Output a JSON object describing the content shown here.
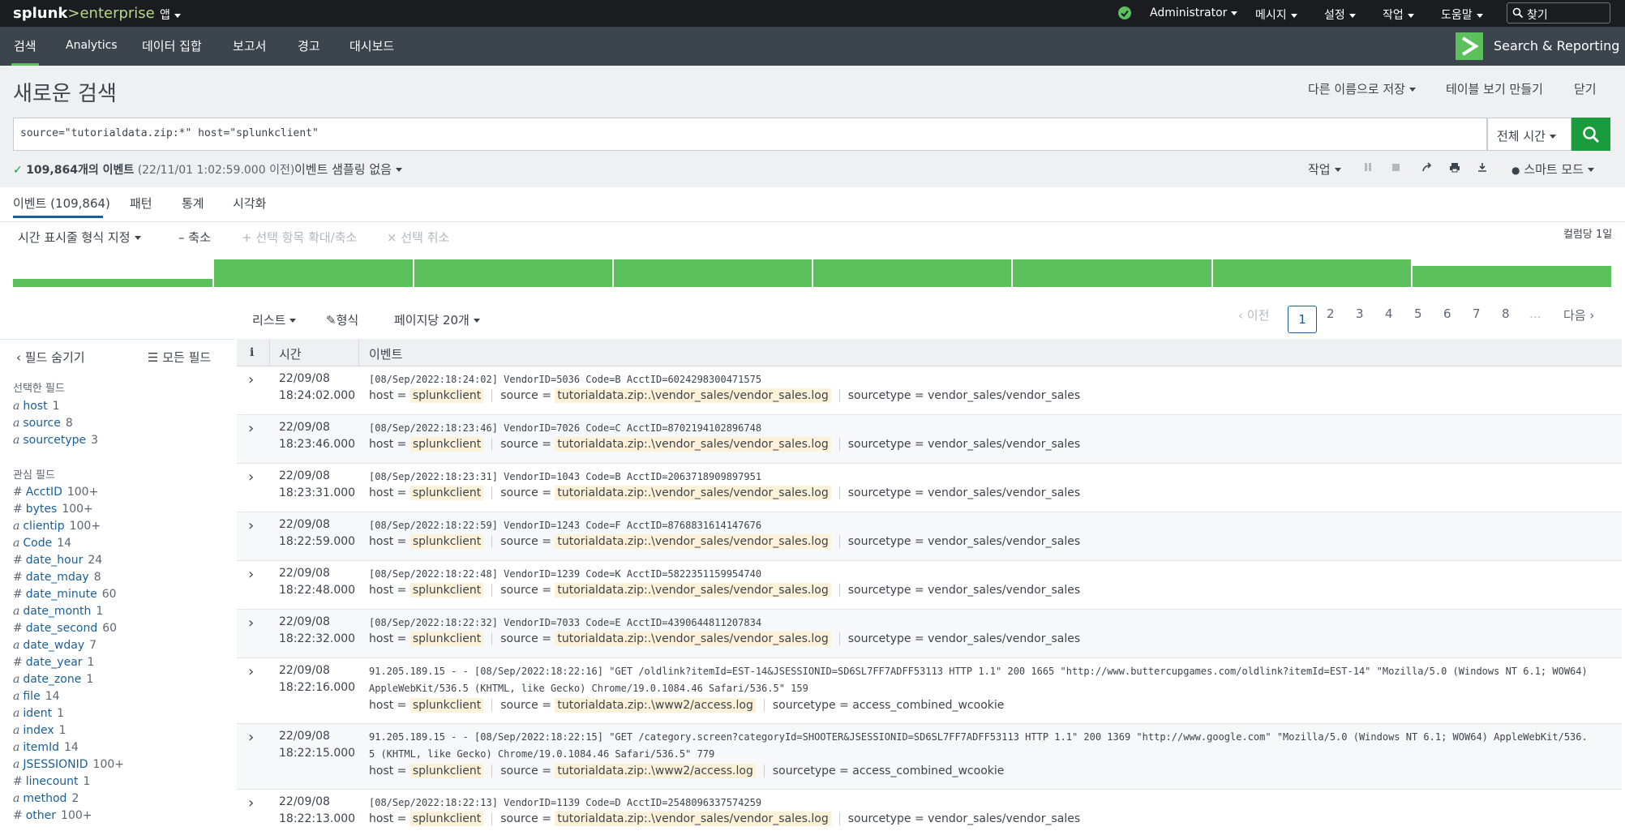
{
  "brand": {
    "logo_a": "splunk",
    "logo_b": ">enterprise"
  },
  "topbar": {
    "app": "앱",
    "user": "Administrator",
    "messages": "메시지",
    "settings": "설정",
    "activity": "작업",
    "help": "도움말",
    "search_placeholder": "찾기"
  },
  "navbar": {
    "items": [
      "검색",
      "Analytics",
      "데이터 집합",
      "보고서",
      "경고",
      "대시보드"
    ],
    "app_title": "Search & Reporting"
  },
  "page": {
    "title": "새로운 검색",
    "save_as": "다른 이름으로 저장",
    "create_table": "테이블 보기 만들기",
    "close": "닫기"
  },
  "search": {
    "query": "source=\"tutorialdata.zip:*\" host=\"splunkclient\"",
    "time_range": "전체 시간"
  },
  "status": {
    "count": "109,864개의 이벤트",
    "range": "(22/11/01 1:02:59.000 이전)",
    "sampling": "이벤트 샘플링 없음",
    "job": "작업",
    "mode": "스마트 모드"
  },
  "tabs": [
    "이벤트 (109,864)",
    "패턴",
    "통계",
    "시각화"
  ],
  "timeline": {
    "format": "시간 표시줄 형식 지정",
    "zoom_out": "– 축소",
    "zoom_sel": "+ 선택 항목 확대/축소",
    "deselect": "× 선택 취소",
    "per_column": "컬럼당 1일"
  },
  "results": {
    "list": "리스트",
    "format": "형식",
    "per_page": "페이지당 20개",
    "prev": "이전",
    "pages": [
      "1",
      "2",
      "3",
      "4",
      "5",
      "6",
      "7",
      "8",
      "..."
    ],
    "next": "다음"
  },
  "sidebar": {
    "hide": "필드 숨기기",
    "all": "모든 필드",
    "selected_title": "선택한 필드",
    "selected": [
      {
        "t": "a",
        "n": "host",
        "c": "1"
      },
      {
        "t": "a",
        "n": "source",
        "c": "8"
      },
      {
        "t": "a",
        "n": "sourcetype",
        "c": "3"
      }
    ],
    "interesting_title": "관심 필드",
    "interesting": [
      {
        "t": "#",
        "n": "AcctID",
        "c": "100+"
      },
      {
        "t": "#",
        "n": "bytes",
        "c": "100+"
      },
      {
        "t": "a",
        "n": "clientip",
        "c": "100+"
      },
      {
        "t": "a",
        "n": "Code",
        "c": "14"
      },
      {
        "t": "#",
        "n": "date_hour",
        "c": "24"
      },
      {
        "t": "#",
        "n": "date_mday",
        "c": "8"
      },
      {
        "t": "#",
        "n": "date_minute",
        "c": "60"
      },
      {
        "t": "a",
        "n": "date_month",
        "c": "1"
      },
      {
        "t": "#",
        "n": "date_second",
        "c": "60"
      },
      {
        "t": "a",
        "n": "date_wday",
        "c": "7"
      },
      {
        "t": "#",
        "n": "date_year",
        "c": "1"
      },
      {
        "t": "a",
        "n": "date_zone",
        "c": "1"
      },
      {
        "t": "a",
        "n": "file",
        "c": "14"
      },
      {
        "t": "a",
        "n": "ident",
        "c": "1"
      },
      {
        "t": "a",
        "n": "index",
        "c": "1"
      },
      {
        "t": "a",
        "n": "itemId",
        "c": "14"
      },
      {
        "t": "a",
        "n": "JSESSIONID",
        "c": "100+"
      },
      {
        "t": "#",
        "n": "linecount",
        "c": "1"
      },
      {
        "t": "a",
        "n": "method",
        "c": "2"
      },
      {
        "t": "#",
        "n": "other",
        "c": "100+"
      }
    ]
  },
  "table": {
    "col_i": "i",
    "col_time": "시간",
    "col_event": "이벤트"
  },
  "labels": {
    "host": "host =",
    "source": "source =",
    "sourcetype": "sourcetype ="
  },
  "events": [
    {
      "date": "22/09/08",
      "time": "18:24:02.000",
      "raw": "[08/Sep/2022:18:24:02] VendorID=5036 Code=B AcctID=6024298300471575",
      "host": "splunkclient",
      "source": "tutorialdata.zip:.\\vendor_sales/vendor_sales.log",
      "sourcetype": "vendor_sales/vendor_sales"
    },
    {
      "date": "22/09/08",
      "time": "18:23:46.000",
      "raw": "[08/Sep/2022:18:23:46] VendorID=7026 Code=C AcctID=8702194102896748",
      "host": "splunkclient",
      "source": "tutorialdata.zip:.\\vendor_sales/vendor_sales.log",
      "sourcetype": "vendor_sales/vendor_sales"
    },
    {
      "date": "22/09/08",
      "time": "18:23:31.000",
      "raw": "[08/Sep/2022:18:23:31] VendorID=1043 Code=B AcctID=2063718909897951",
      "host": "splunkclient",
      "source": "tutorialdata.zip:.\\vendor_sales/vendor_sales.log",
      "sourcetype": "vendor_sales/vendor_sales"
    },
    {
      "date": "22/09/08",
      "time": "18:22:59.000",
      "raw": "[08/Sep/2022:18:22:59] VendorID=1243 Code=F AcctID=8768831614147676",
      "host": "splunkclient",
      "source": "tutorialdata.zip:.\\vendor_sales/vendor_sales.log",
      "sourcetype": "vendor_sales/vendor_sales"
    },
    {
      "date": "22/09/08",
      "time": "18:22:48.000",
      "raw": "[08/Sep/2022:18:22:48] VendorID=1239 Code=K AcctID=5822351159954740",
      "host": "splunkclient",
      "source": "tutorialdata.zip:.\\vendor_sales/vendor_sales.log",
      "sourcetype": "vendor_sales/vendor_sales"
    },
    {
      "date": "22/09/08",
      "time": "18:22:32.000",
      "raw": "[08/Sep/2022:18:22:32] VendorID=7033 Code=E AcctID=4390644811207834",
      "host": "splunkclient",
      "source": "tutorialdata.zip:.\\vendor_sales/vendor_sales.log",
      "sourcetype": "vendor_sales/vendor_sales"
    },
    {
      "date": "22/09/08",
      "time": "18:22:16.000",
      "raw": "91.205.189.15 - - [08/Sep/2022:18:22:16] \"GET /oldlink?itemId=EST-14&JSESSIONID=SD6SL7FF7ADFF53113 HTTP 1.1\" 200 1665 \"http://www.buttercupgames.com/oldlink?itemId=EST-14\" \"Mozilla/5.0 (Windows NT 6.1; WOW64)",
      "raw2": "AppleWebKit/536.5 (KHTML, like Gecko) Chrome/19.0.1084.46 Safari/536.5\" 159",
      "host": "splunkclient",
      "source": "tutorialdata.zip:.\\www2/access.log",
      "sourcetype": "access_combined_wcookie"
    },
    {
      "date": "22/09/08",
      "time": "18:22:15.000",
      "raw": "91.205.189.15 - - [08/Sep/2022:18:22:15] \"GET /category.screen?categoryId=SHOOTER&JSESSIONID=SD6SL7FF7ADFF53113 HTTP 1.1\" 200 1369 \"http://www.google.com\" \"Mozilla/5.0 (Windows NT 6.1; WOW64) AppleWebKit/536.",
      "raw2": "5 (KHTML, like Gecko) Chrome/19.0.1084.46 Safari/536.5\" 779",
      "host": "splunkclient",
      "source": "tutorialdata.zip:.\\www2/access.log",
      "sourcetype": "access_combined_wcookie"
    },
    {
      "date": "22/09/08",
      "time": "18:22:13.000",
      "raw": "[08/Sep/2022:18:22:13] VendorID=1139 Code=D AcctID=2548096337574259",
      "host": "splunkclient",
      "source": "tutorialdata.zip:.\\vendor_sales/vendor_sales.log",
      "sourcetype": "vendor_sales/vendor_sales"
    }
  ],
  "colors": {
    "accent": "#5cc05c",
    "link": "#1a5f9a",
    "nav_bg": "#3c444d",
    "top_bg": "#1a1c20",
    "search_btn": "#1a9c3e"
  }
}
